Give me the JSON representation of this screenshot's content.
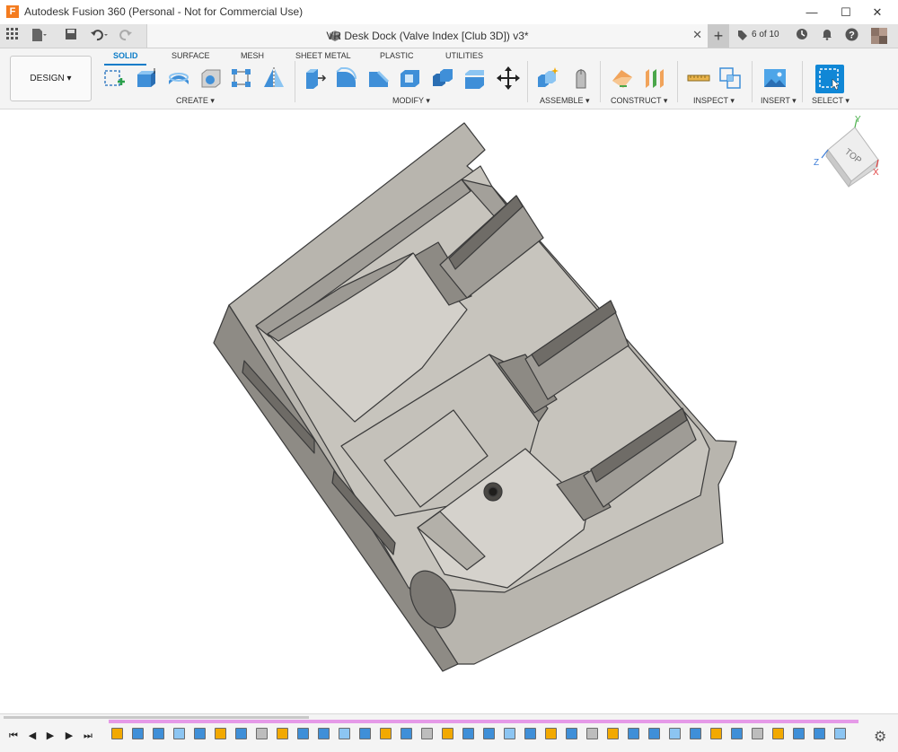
{
  "window": {
    "title": "Autodesk Fusion 360 (Personal - Not for Commercial Use)",
    "app_icon_letter": "F",
    "minimize": "—",
    "maximize": "☐",
    "close": "✕"
  },
  "tabbar": {
    "document_title": "VR Desk Dock (Valve Index [Club 3D]) v3*",
    "close": "✕",
    "add": "+",
    "jobs": "6 of 10"
  },
  "workspace": {
    "label": "DESIGN ▾"
  },
  "ribbon": {
    "tabs": [
      "SOLID",
      "SURFACE",
      "MESH",
      "SHEET METAL",
      "PLASTIC",
      "UTILITIES"
    ],
    "active_tab": "SOLID",
    "groups": [
      "CREATE ▾",
      "MODIFY ▾",
      "ASSEMBLE ▾",
      "CONSTRUCT ▾",
      "INSPECT ▾",
      "INSERT ▾",
      "SELECT ▾"
    ]
  },
  "viewcube": {
    "face": "TOP",
    "axis_x": "X",
    "axis_y": "Y",
    "axis_z": "Z"
  },
  "timeline": {
    "first": "⏮",
    "prev": "◀",
    "play": "▶",
    "next": "▶",
    "last": "⏭",
    "settings": "⚙"
  },
  "colors": {
    "accent": "#0d7cc8",
    "timeline_track": "#e59ae8",
    "model_face": "#c7c4bd",
    "model_edge": "#3a3a3a"
  }
}
